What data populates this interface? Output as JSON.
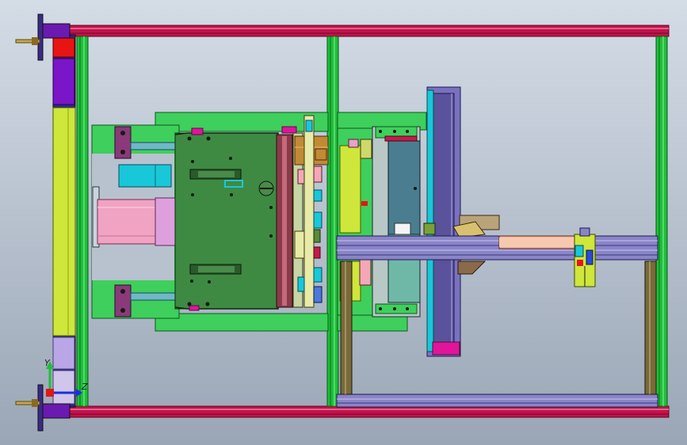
{
  "viewport": {
    "background_top": "#d4dce6",
    "background_bottom": "#9aa6b6"
  },
  "triad": {
    "y_label": "Y",
    "z_label": "Z"
  },
  "palette": {
    "frame_rail": "#c4124b",
    "frame_post": "#1fbf3a",
    "mold_base": "#3fcf5c",
    "mold_plate": "#3e8a43",
    "guide_block": "#8a3a78",
    "cylinder": "#f0a3c2",
    "cylinder_head": "#dda0dd",
    "cyan": "#18c8d8",
    "slide": "#7a72c0",
    "slide_dark": "#5a529a",
    "magenta": "#e0159a",
    "yellow_green": "#cfe63a",
    "steel_blue": "#4a7d8f",
    "bronze": "#c28a35",
    "salmon": "#f2b49a",
    "tan": "#b9a37a",
    "red": "#e81414",
    "purple": "#7a16c8",
    "olive_rail": "#7a6a3a",
    "axis_x": "#1b2fe0",
    "axis_y": "#1fbf3a",
    "axis_z": "#e01818"
  }
}
